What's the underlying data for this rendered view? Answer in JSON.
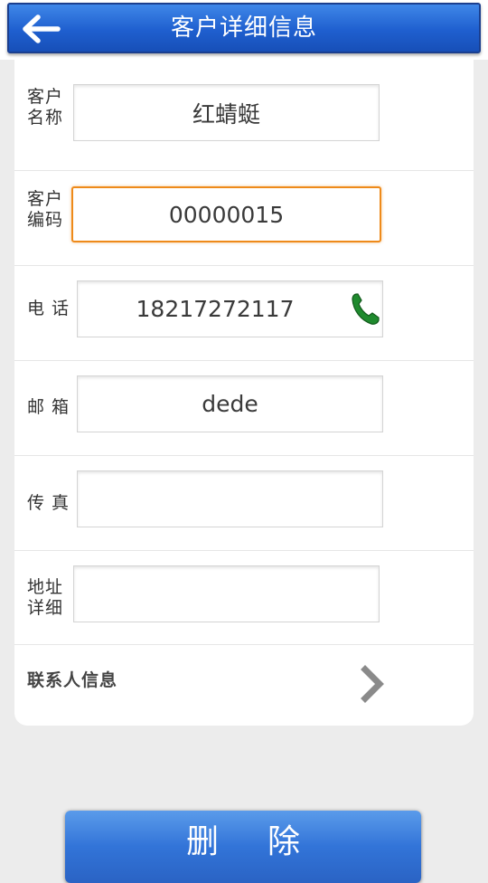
{
  "header": {
    "title": "客户详细信息",
    "back_icon": "arrow-left-icon"
  },
  "form": {
    "customer_name": {
      "label": "客户名称",
      "label_line1": "客户",
      "label_line2": "名称",
      "value": "红蜻蜓"
    },
    "customer_code": {
      "label": "客户编码",
      "label_line1": "客户",
      "label_line2": "编码",
      "value": "00000015"
    },
    "phone": {
      "label": "电 话",
      "value": "18217272117",
      "icon": "phone-icon"
    },
    "email": {
      "label": "邮 箱",
      "value": "dede"
    },
    "fax": {
      "label": "传 真",
      "value": ""
    },
    "address": {
      "label": "地址详细",
      "label_line1": "地址",
      "label_line2": "详细",
      "value": ""
    }
  },
  "contact_info": {
    "label": "联系人信息",
    "icon": "chevron-right-icon"
  },
  "actions": {
    "delete_label": "删除"
  },
  "colors": {
    "header_blue": "#1f5fcf",
    "focus_orange": "#ee8a1a",
    "phone_green": "#1f8a2e",
    "button_blue": "#3274d8"
  }
}
